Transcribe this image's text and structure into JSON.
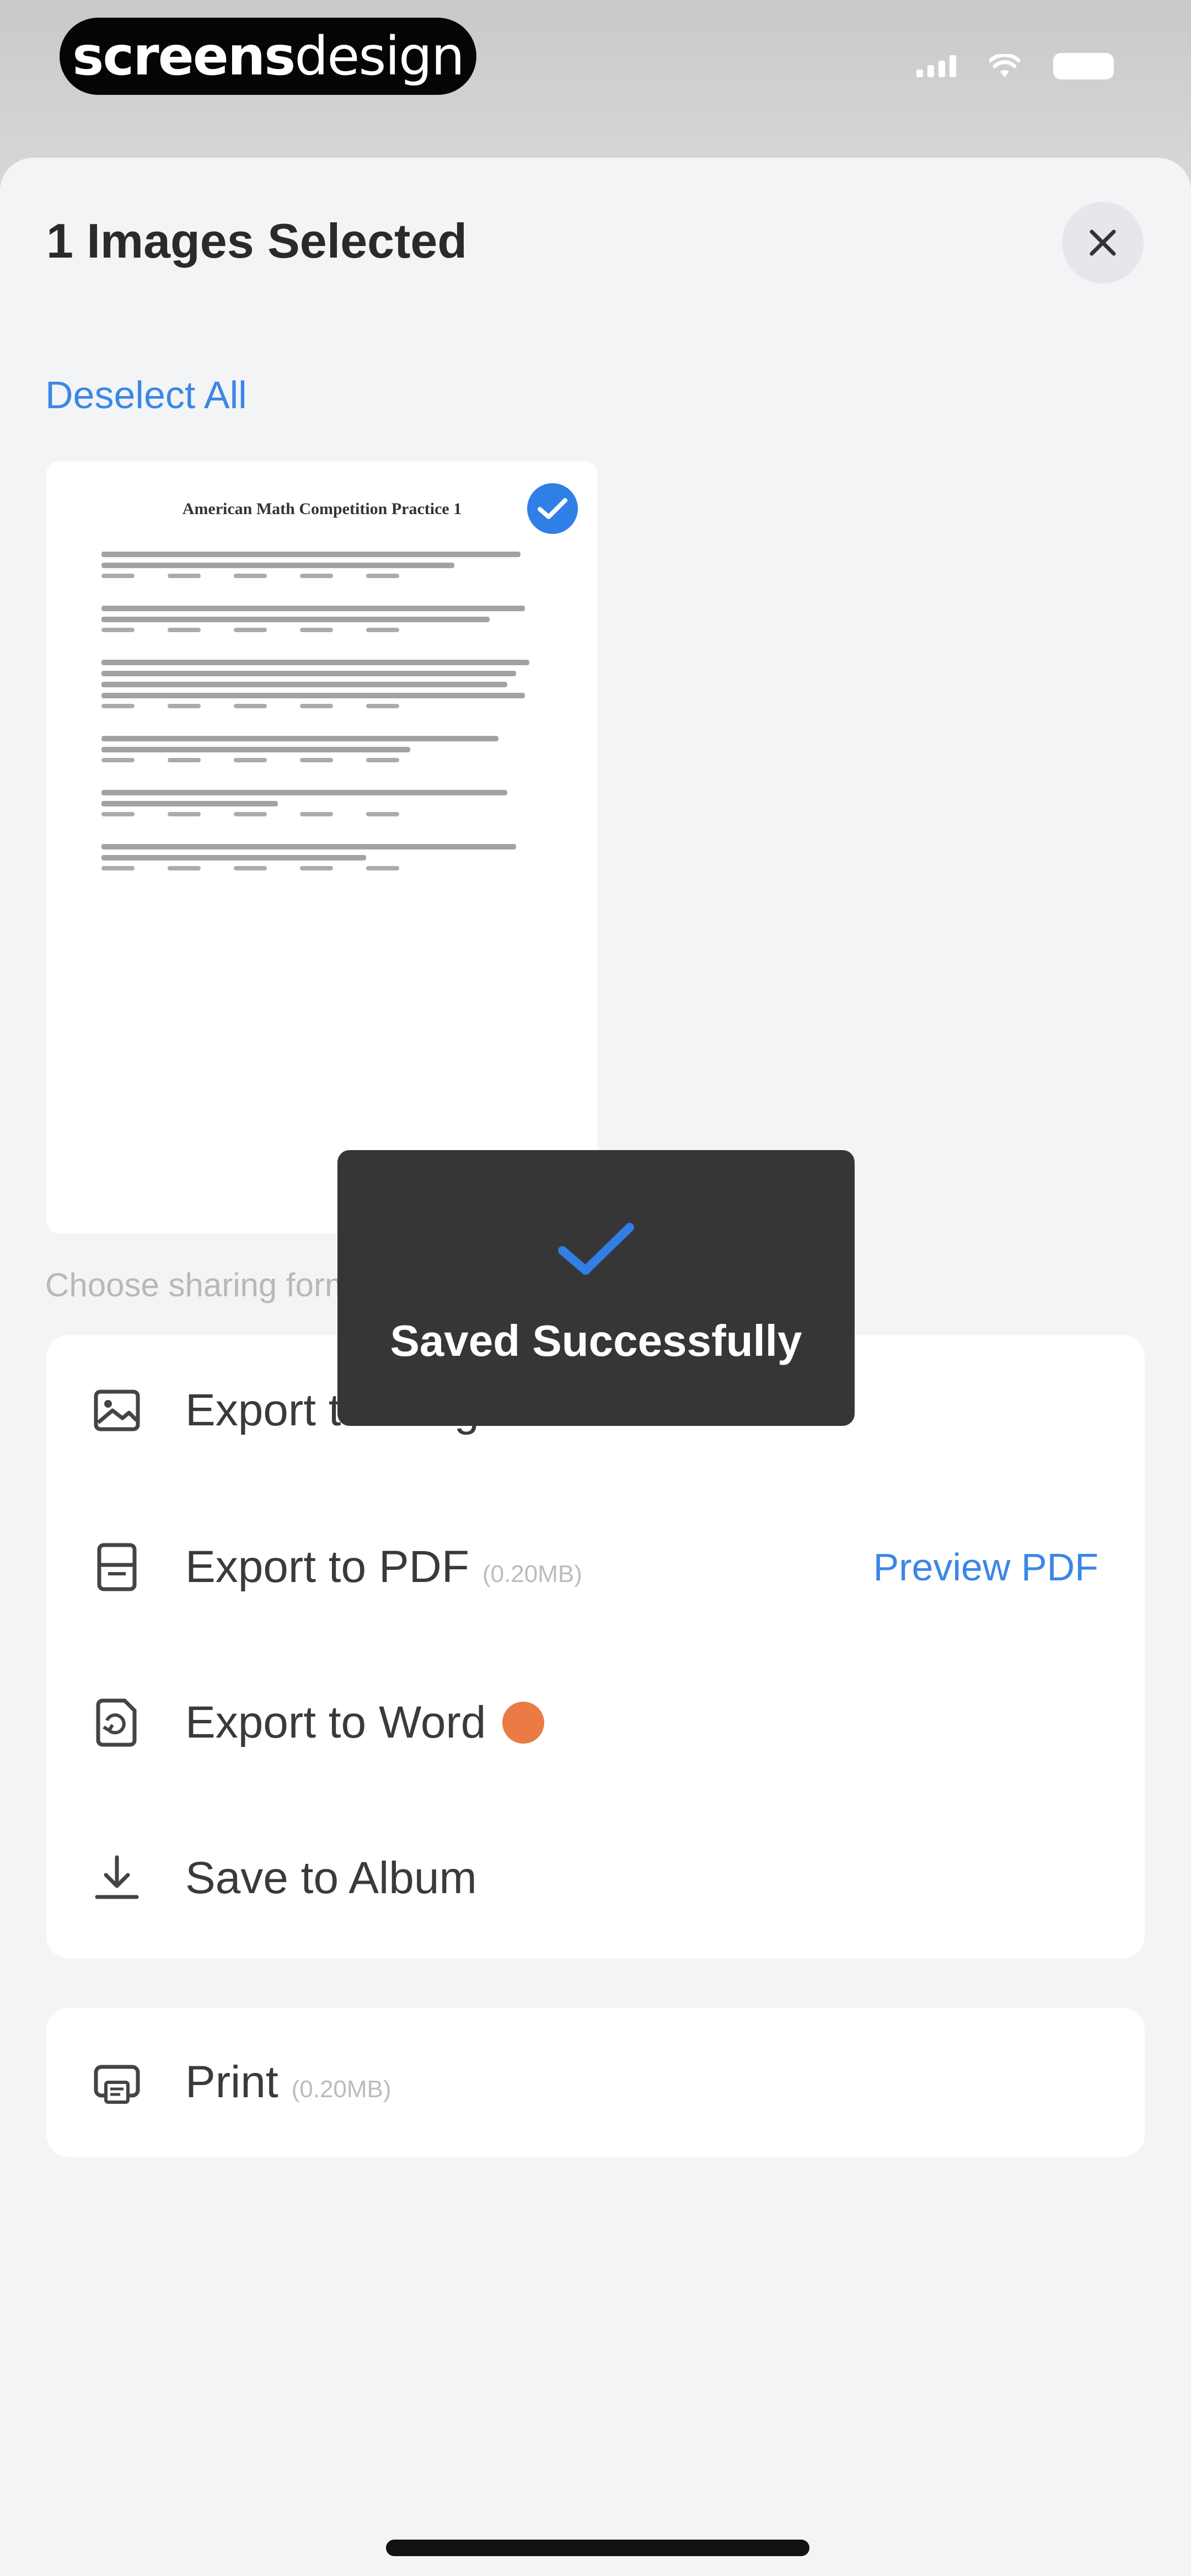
{
  "status_bar": {
    "brand_part1": "screens",
    "brand_part2": "design"
  },
  "sheet": {
    "title": "1 Images Selected",
    "close_icon": "close-icon",
    "deselect_label": "Deselect All"
  },
  "thumbnail": {
    "doc_title": "American Math Competition Practice 1",
    "selected": true
  },
  "section_label": "Choose sharing form",
  "options": [
    {
      "label": "Export to Images",
      "meta": "",
      "icon": "image-icon"
    },
    {
      "label": "Export to PDF",
      "meta": "(0.20MB)",
      "icon": "pdf-file-icon",
      "link": "Preview PDF"
    },
    {
      "label": "Export to Word",
      "meta": "",
      "icon": "word-file-icon",
      "badge_color": "#ec7a44"
    },
    {
      "label": "Save to Album",
      "meta": "",
      "icon": "download-icon"
    }
  ],
  "print": {
    "label": "Print",
    "meta": "(0.20MB)",
    "icon": "printer-icon"
  },
  "toast": {
    "message": "Saved Successfully",
    "icon": "checkmark-icon"
  },
  "colors": {
    "accent": "#3c86e6",
    "check_badge": "#2f7fe6",
    "toast_bg": "#363636",
    "word_badge": "#ec7a44"
  }
}
